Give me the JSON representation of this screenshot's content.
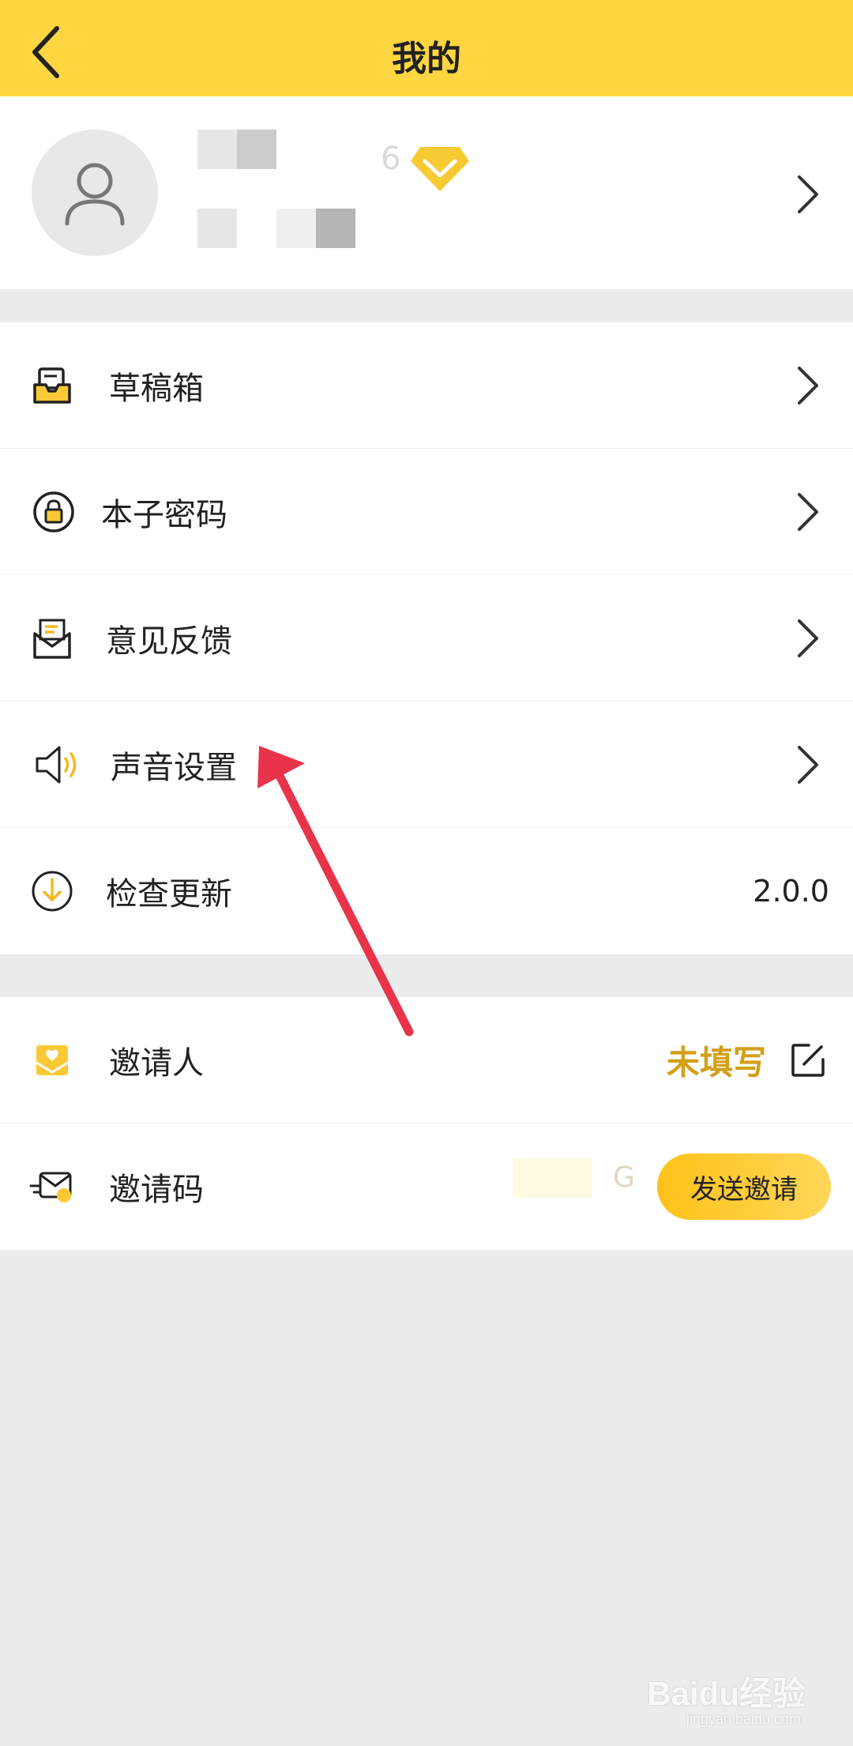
{
  "header": {
    "title": "我的"
  },
  "profile": {
    "name_suffix": "6"
  },
  "menu": {
    "drafts": "草稿箱",
    "book_password": "本子密码",
    "feedback": "意见反馈",
    "sound_settings": "声音设置",
    "check_update": "检查更新",
    "version": "2.0.0"
  },
  "invite": {
    "inviter_label": "邀请人",
    "inviter_value": "未填写",
    "code_label": "邀请码",
    "code_suffix": "G",
    "send_button": "发送邀请"
  },
  "watermark": {
    "brand": "Baidu经验",
    "url": "jingyan.baidu.com"
  },
  "colors": {
    "header_bg": "#ffd640",
    "accent": "#d3a01a",
    "arrow": "#e8334a"
  }
}
